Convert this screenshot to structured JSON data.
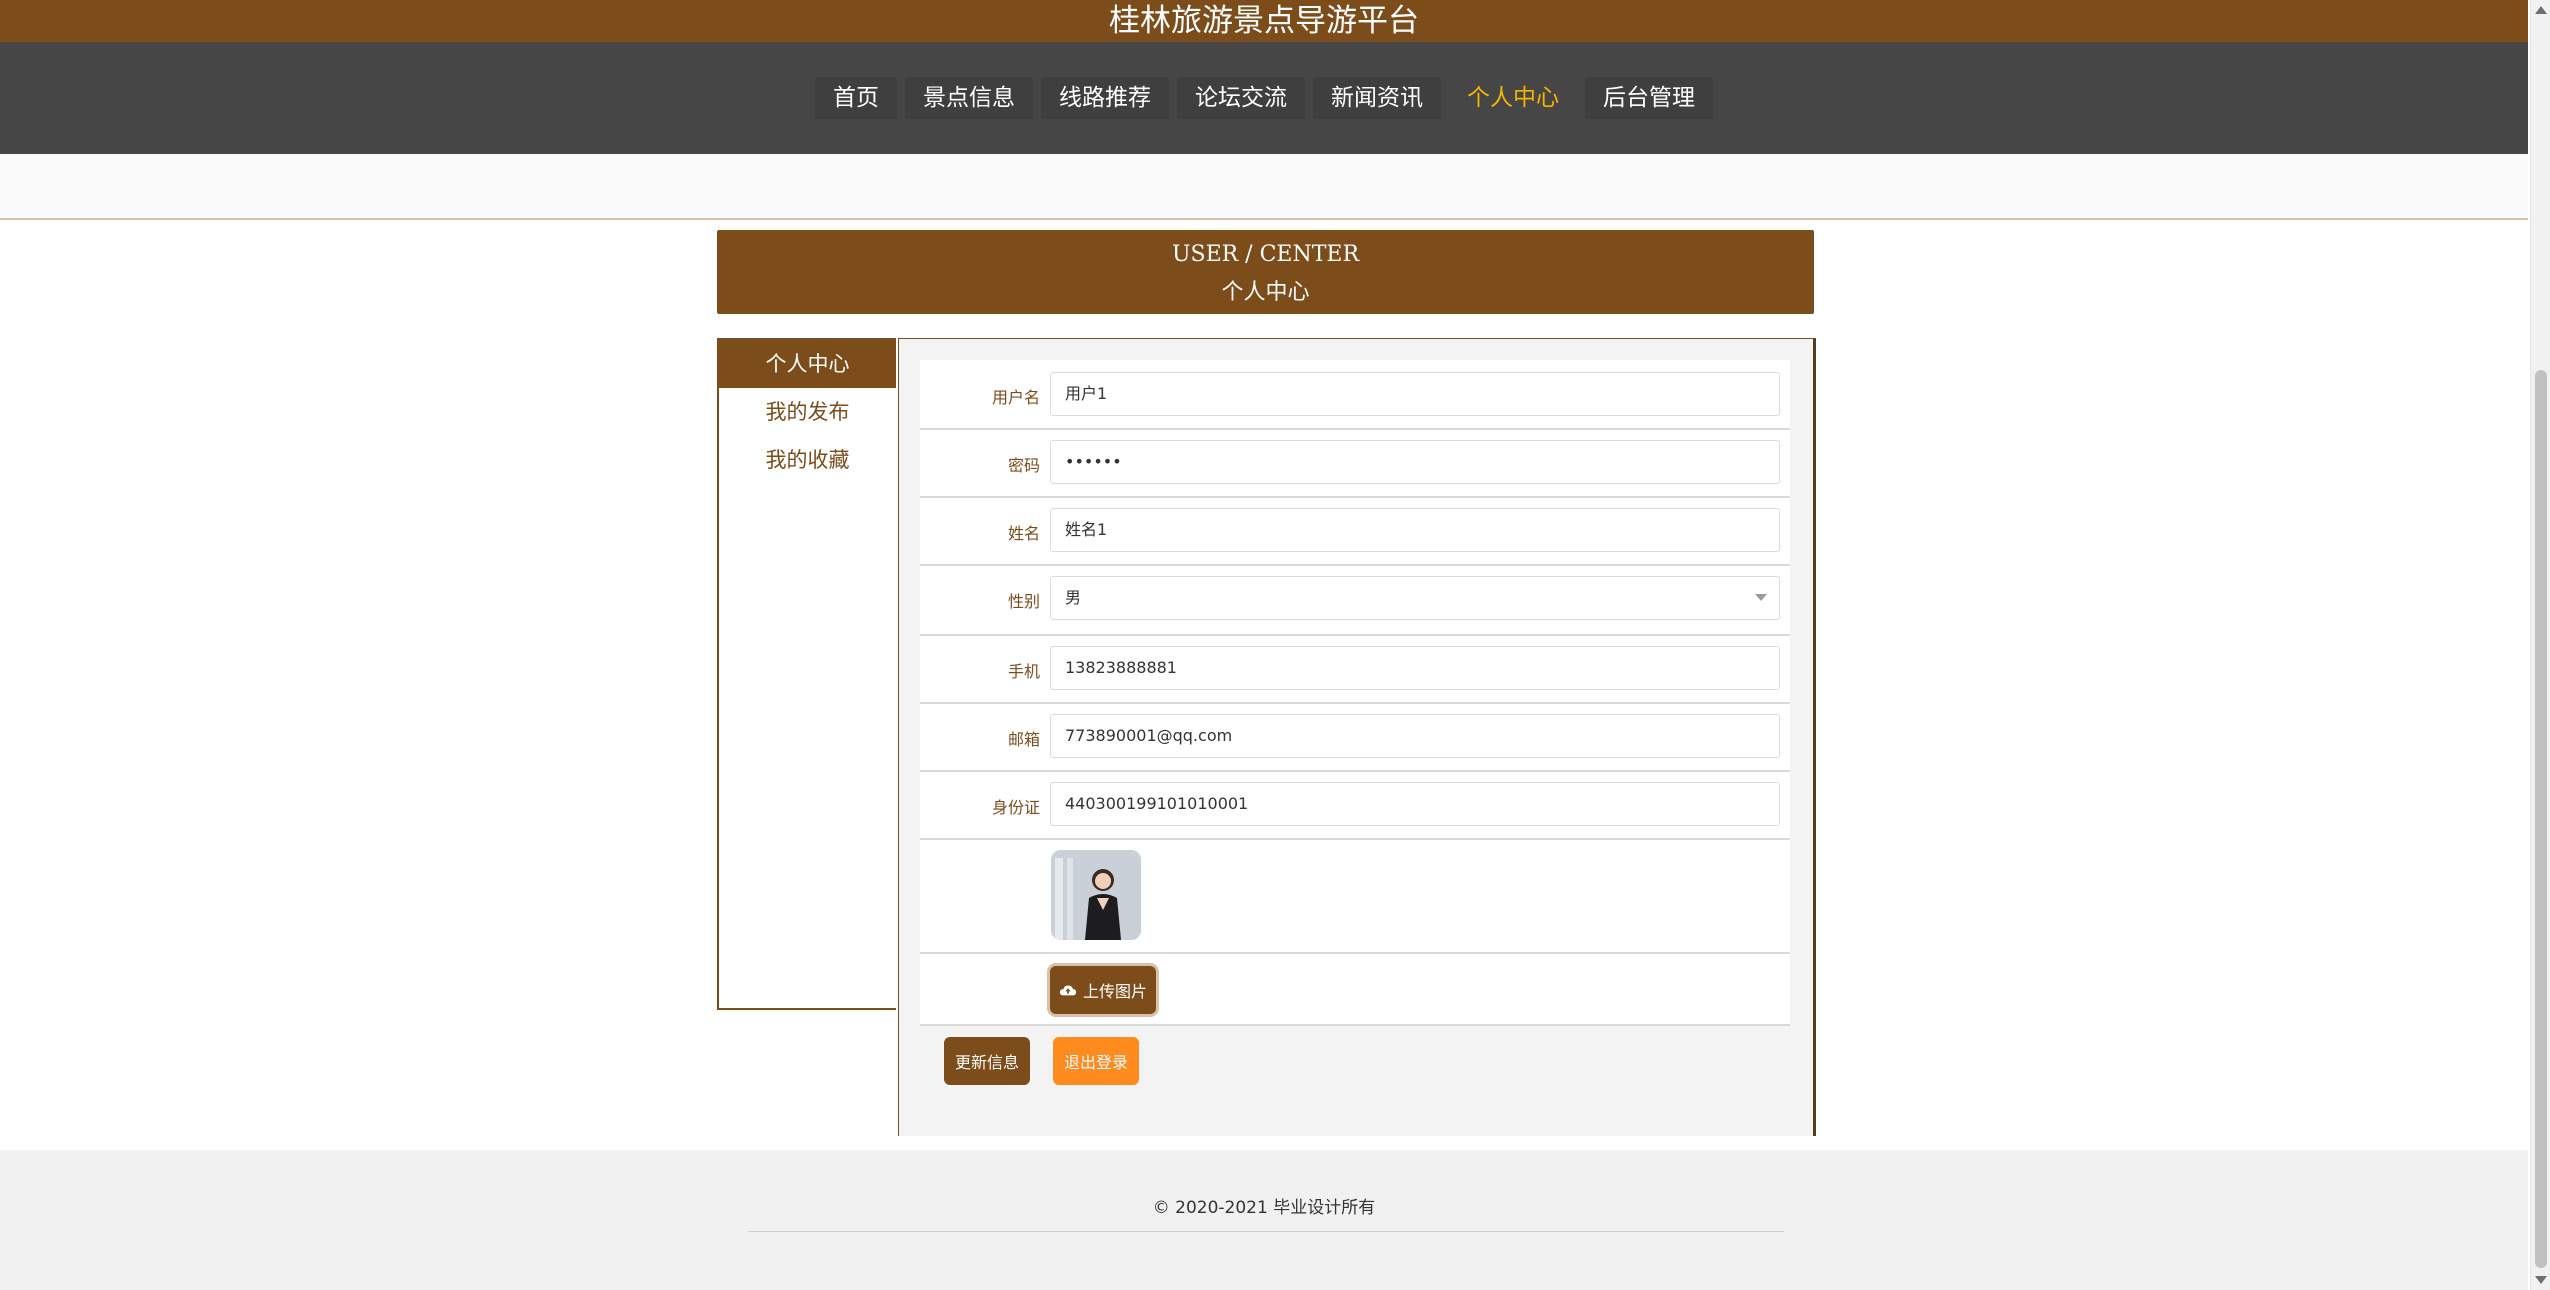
{
  "header": {
    "title": "桂林旅游景点导游平台"
  },
  "nav": {
    "items": [
      "首页",
      "景点信息",
      "线路推荐",
      "论坛交流",
      "新闻资讯",
      "个人中心",
      "后台管理"
    ],
    "active_index": 5
  },
  "section": {
    "title_en": "USER / CENTER",
    "title_cn": "个人中心"
  },
  "sidebar": {
    "items": [
      "个人中心",
      "我的发布",
      "我的收藏"
    ],
    "active_index": 0
  },
  "form": {
    "username": {
      "label": "用户名",
      "value": "用户1"
    },
    "password": {
      "label": "密码",
      "value": "••••••"
    },
    "name": {
      "label": "姓名",
      "value": "姓名1"
    },
    "gender": {
      "label": "性别",
      "value": "男"
    },
    "phone": {
      "label": "手机",
      "value": "13823888881"
    },
    "email": {
      "label": "邮箱",
      "value": "773890001@qq.com"
    },
    "id_card": {
      "label": "身份证",
      "value": "440300199101010001"
    },
    "upload_label": "上传图片"
  },
  "buttons": {
    "update": "更新信息",
    "logout": "退出登录"
  },
  "footer": {
    "copyright": "© 2020-2021 毕业设计所有"
  },
  "colors": {
    "brand": "#7d4c1b",
    "nav_bg": "#464646",
    "active_nav": "#f4b400",
    "logout": "#ff8a1e"
  }
}
